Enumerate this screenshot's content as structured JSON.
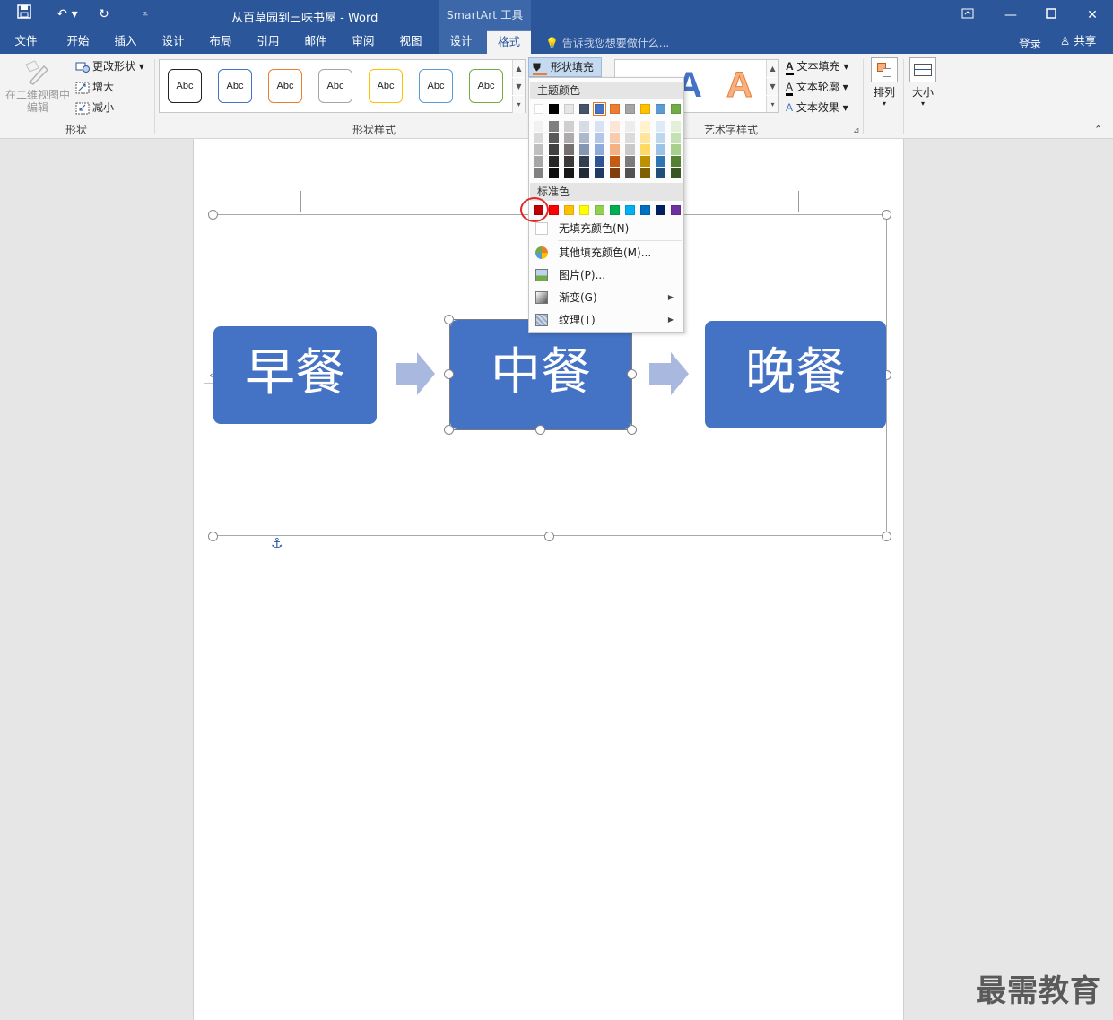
{
  "titlebar": {
    "title": "从百草园到三味书屋 - Word",
    "context_tab_header": "SmartArt 工具"
  },
  "tabs": [
    {
      "label": "文件"
    },
    {
      "label": "开始"
    },
    {
      "label": "插入"
    },
    {
      "label": "设计"
    },
    {
      "label": "布局"
    },
    {
      "label": "引用"
    },
    {
      "label": "邮件"
    },
    {
      "label": "审阅"
    },
    {
      "label": "视图"
    },
    {
      "label": "设计"
    },
    {
      "label": "格式"
    }
  ],
  "tellme": {
    "placeholder": "告诉我您想要做什么..."
  },
  "account": {
    "login": "登录",
    "share": "共享"
  },
  "ribbon": {
    "shape_group": {
      "edit_2d": "在二维视图中编辑",
      "change_shape": "更改形状",
      "larger": "增大",
      "smaller": "减小",
      "label": "形状"
    },
    "shape_styles": {
      "label": "形状样式",
      "swatch_text": "Abc",
      "swatch_colors": [
        "#222222",
        "#4472c4",
        "#ed7d31",
        "#a5a5a5",
        "#ffc000",
        "#5b9bd5",
        "#70ad47"
      ]
    },
    "shape_fill": {
      "label": "形状填充"
    },
    "wordart": {
      "label": "艺术字样式",
      "text_fill": "文本填充",
      "text_outline": "文本轮廓",
      "text_effects": "文本效果",
      "letter": "A"
    },
    "arrange": {
      "label": "排列"
    },
    "size": {
      "label": "大小"
    }
  },
  "dropdown": {
    "theme_colors_header": "主题颜色",
    "standard_colors_header": "标准色",
    "theme_row": [
      "#ffffff",
      "#000000",
      "#e7e6e6",
      "#44546a",
      "#4472c4",
      "#ed7d31",
      "#a5a5a5",
      "#ffc000",
      "#5b9bd5",
      "#70ad47"
    ],
    "theme_shades": [
      [
        "#f2f2f2",
        "#d9d9d9",
        "#bfbfbf",
        "#a6a6a6",
        "#808080"
      ],
      [
        "#7f7f7f",
        "#595959",
        "#404040",
        "#262626",
        "#0d0d0d"
      ],
      [
        "#d0cece",
        "#aeabab",
        "#757171",
        "#3a3838",
        "#171616"
      ],
      [
        "#d6dce4",
        "#adb9ca",
        "#8496b0",
        "#333f4f",
        "#222a35"
      ],
      [
        "#d9e2f3",
        "#b4c6e7",
        "#8eaadb",
        "#2f5496",
        "#1f3864"
      ],
      [
        "#fbe5d5",
        "#f7cbac",
        "#f4b183",
        "#c55a11",
        "#833c0b"
      ],
      [
        "#ededed",
        "#dbdbdb",
        "#c9c9c9",
        "#7b7b7b",
        "#525252"
      ],
      [
        "#fff2cc",
        "#fee599",
        "#ffd965",
        "#bf9000",
        "#7f6000"
      ],
      [
        "#deebf6",
        "#bdd7ee",
        "#9cc3e5",
        "#2e75b5",
        "#1e4e79"
      ],
      [
        "#e2efd9",
        "#c5e0b3",
        "#a8d08d",
        "#538135",
        "#375623"
      ]
    ],
    "standard_row": [
      "#c00000",
      "#ff0000",
      "#ffc000",
      "#ffff00",
      "#92d050",
      "#00b050",
      "#00b0f0",
      "#0070c0",
      "#002060",
      "#7030a0"
    ],
    "no_fill": "无填充颜色(N)",
    "more_colors": "其他填充颜色(M)...",
    "picture": "图片(P)...",
    "gradient": "渐变(G)",
    "texture": "纹理(T)"
  },
  "smartart": {
    "nodes": [
      "早餐",
      "中餐",
      "晚餐"
    ],
    "node_color": "#4472c4",
    "arrow_color": "#a9b8de"
  },
  "watermark": "最需教育"
}
